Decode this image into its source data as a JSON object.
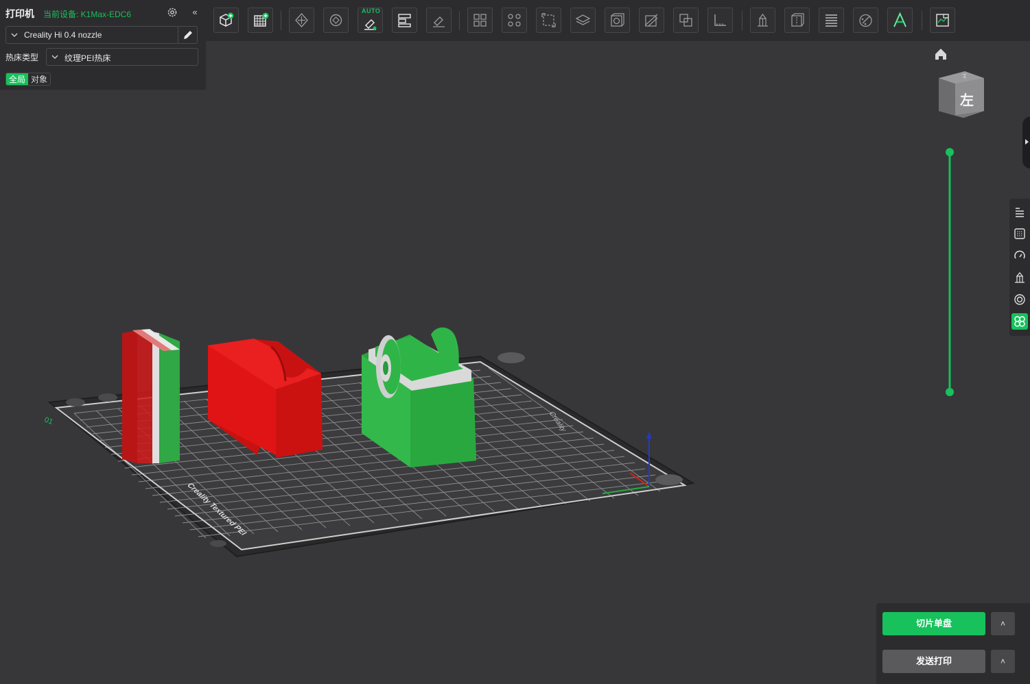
{
  "printer": {
    "title": "打印机",
    "current_device": "当前设备: K1Max-EDC6",
    "nozzle_profile": "Creality Hi 0.4 nozzle",
    "bed_type_label": "热床类型",
    "bed_type_value": "纹理PEI热床",
    "scope_global": "全局",
    "scope_object": "对象"
  },
  "toolbar": {
    "auto_orient_badge": "AUTO",
    "icons": [
      "add-cube-icon",
      "add-plate-icon",
      "arrange-icon",
      "orient-icon",
      "auto-orient-icon",
      "layout-icon",
      "paint-icon",
      "split-objects-icon",
      "split-parts-icon",
      "scale-icon",
      "layers-icon",
      "hollow-icon",
      "cut-icon",
      "boolean-icon",
      "measure-icon",
      "support-paint-icon",
      "seam-icon",
      "slice-layers-icon",
      "color-paint-icon",
      "text-icon",
      "assembly-view-icon"
    ]
  },
  "viewport": {
    "view_cube_face": "左",
    "bed_label_front": "Creality Textured PEI",
    "bed_label_side": "Creality",
    "plate_number": "01"
  },
  "right_rail": {
    "icons": [
      "object-list-icon",
      "plate-icon",
      "speed-icon",
      "support-icon",
      "wall-icon",
      "multi-material-icon"
    ],
    "active": "multi-material-icon"
  },
  "actions": {
    "slice_label": "切片单盘",
    "send_label": "发送打印",
    "caret": "˄"
  },
  "colors": {
    "accent": "#17c15b",
    "model_red": "#e01414",
    "model_green": "#2fb547"
  }
}
